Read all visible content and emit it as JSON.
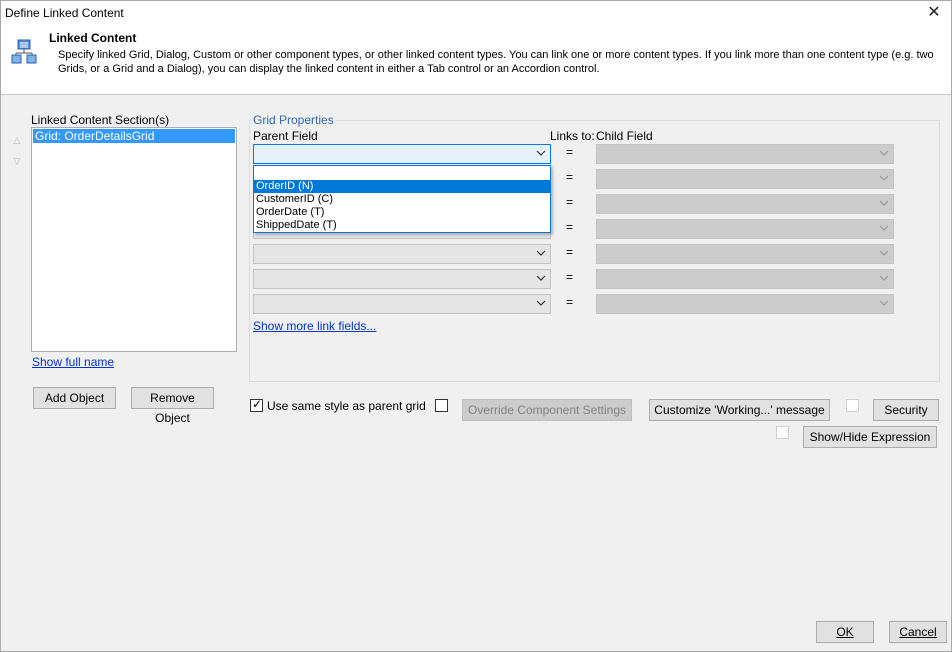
{
  "window": {
    "title": "Define Linked Content",
    "close_glyph": "✕"
  },
  "header": {
    "title": "Linked Content",
    "description": "Specify linked Grid, Dialog, Custom or other component types, or other linked content types. You can link one or more content types. If you link more than one content type (e.g. two Grids, or a Grid and a Dialog), you can display the linked content in either a Tab control or an Accordion control.",
    "icon": "linked-content-icon"
  },
  "sections": {
    "label": "Linked Content Section(s)",
    "items": [
      "Grid: OrderDetailsGrid"
    ],
    "show_full_name": "Show full name",
    "add_button": "Add Object",
    "remove_button": "Remove Object"
  },
  "grid_properties": {
    "group_title": "Grid Properties",
    "parent_field_label": "Parent Field",
    "links_to_label": "Links to:",
    "child_field_label": "Child Field",
    "equals": "=",
    "dropdown_options": [
      "",
      "OrderID (N)",
      "CustomerID (C)",
      "OrderDate (T)",
      "ShippedDate (T)"
    ],
    "selected_option": "OrderID (N)",
    "show_more_link": "Show more link fields..."
  },
  "options": {
    "use_same_style_label": "Use same style as parent grid",
    "use_same_style_checked": true,
    "override_checked": false,
    "override_button": "Override Component Settings",
    "customize_button": "Customize 'Working...' message",
    "security_checked": false,
    "security_button": "Security",
    "show_hide_checked": false,
    "show_hide_button": "Show/Hide Expression"
  },
  "footer": {
    "ok_button": "OK",
    "cancel_button": "Cancel"
  },
  "colors": {
    "accent": "#0078d7",
    "selection": "#3399ff",
    "group_title": "#3068b8",
    "link": "#0033cc"
  }
}
